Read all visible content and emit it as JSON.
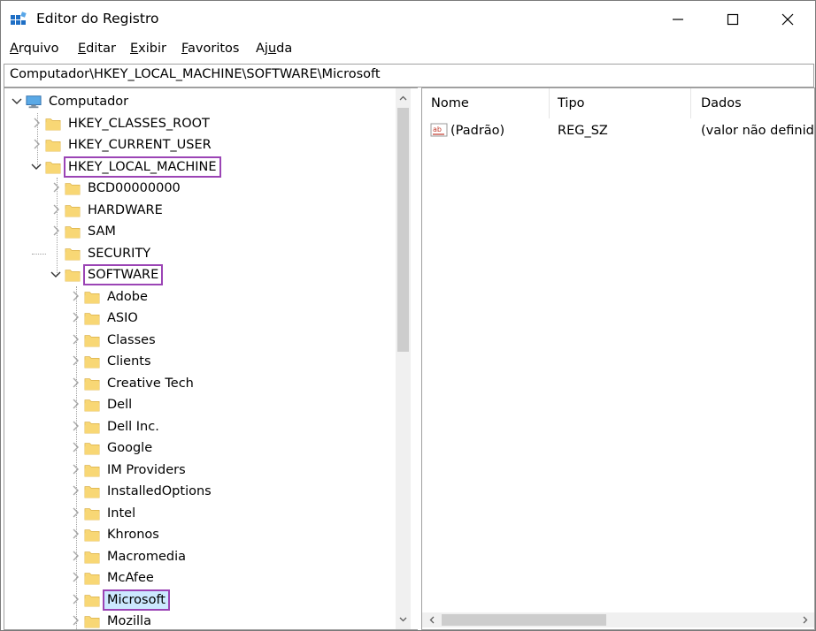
{
  "window": {
    "title": "Editor do Registro"
  },
  "menu": {
    "items": [
      {
        "underline": "A",
        "rest": "rquivo"
      },
      {
        "underline": "E",
        "rest": "ditar"
      },
      {
        "underline": "E",
        "rest": "xibir"
      },
      {
        "underline": "F",
        "rest": "avoritos"
      },
      {
        "pre": "Aj",
        "underline": "u",
        "rest": "da"
      }
    ]
  },
  "address": {
    "path": "Computador\\HKEY_LOCAL_MACHINE\\SOFTWARE\\Microsoft"
  },
  "tree": {
    "root": "Computador",
    "hives": [
      "HKEY_CLASSES_ROOT",
      "HKEY_CURRENT_USER",
      "HKEY_LOCAL_MACHINE"
    ],
    "hklm_children": [
      "BCD00000000",
      "HARDWARE",
      "SAM",
      "SECURITY",
      "SOFTWARE"
    ],
    "software_children": [
      "Adobe",
      "ASIO",
      "Classes",
      "Clients",
      "Creative Tech",
      "Dell",
      "Dell Inc.",
      "Google",
      "IM Providers",
      "InstalledOptions",
      "Intel",
      "Khronos",
      "Macromedia",
      "McAfee",
      "Microsoft",
      "Mozilla"
    ]
  },
  "list": {
    "columns": [
      "Nome",
      "Tipo",
      "Dados"
    ],
    "rows": [
      {
        "name": "(Padrão)",
        "type": "REG_SZ",
        "data": "(valor não definido)"
      }
    ]
  },
  "colors": {
    "highlight": "#9b44b5",
    "selected_bg": "#cce8ff",
    "folder": "#f8d775",
    "folder_edge": "#dcb24a"
  }
}
